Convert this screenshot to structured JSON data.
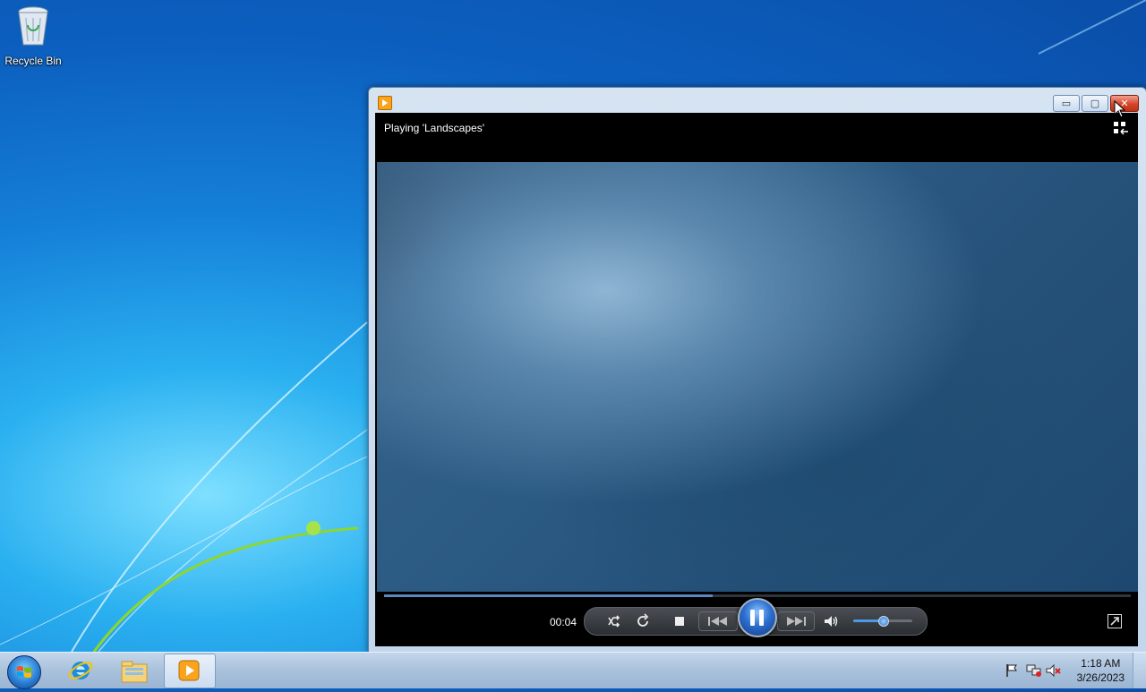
{
  "desktop": {
    "icons": [
      {
        "label": "Recycle Bin",
        "icon": "recycle-bin-icon"
      }
    ]
  },
  "player": {
    "now_playing": "Playing 'Landscapes'",
    "elapsed": "00:04",
    "seek_progress": 0.44,
    "volume_level": 0.5,
    "icons": [
      "shuffle-icon",
      "repeat-icon",
      "stop-icon",
      "previous-icon",
      "pause-icon",
      "next-icon",
      "volume-icon",
      "fullscreen-icon",
      "switch-to-library-icon"
    ]
  },
  "window": {
    "buttons": {
      "minimize": "▭",
      "maximize": "▢",
      "close": "✕"
    }
  },
  "taskbar": {
    "items": [
      "start-orb",
      "internet-explorer-icon",
      "windows-explorer-icon",
      "windows-media-player-icon"
    ],
    "tray_icons": [
      "action-center-flag-icon",
      "network-icon",
      "volume-muted-icon"
    ],
    "time": "1:18 AM",
    "date": "3/26/2023"
  }
}
